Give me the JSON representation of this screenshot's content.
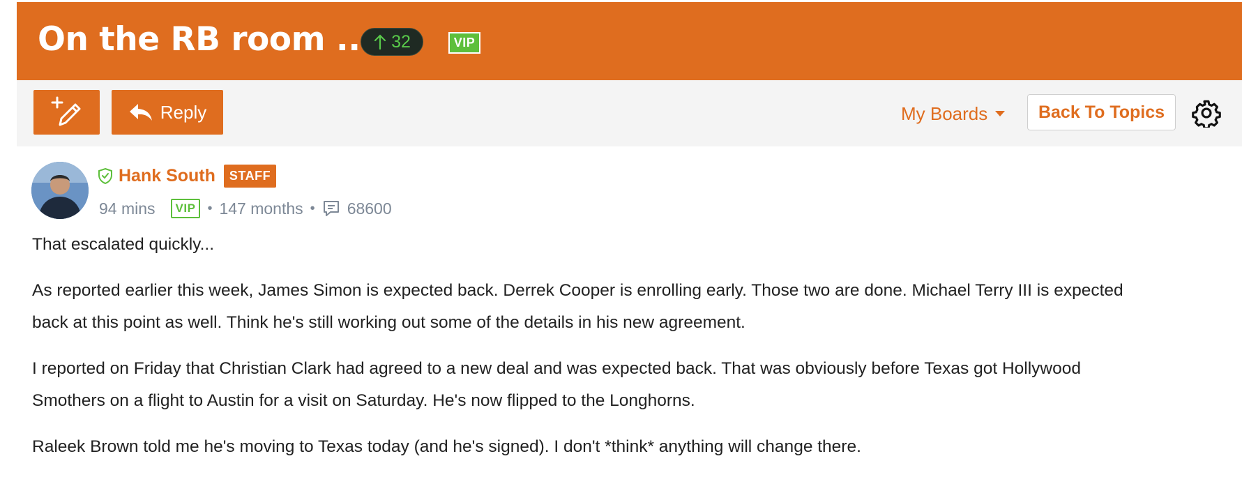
{
  "title_bar": {
    "title": "On the RB room ...",
    "vote_count": "32",
    "vip_label": "VIP",
    "bg_color": "#df6d1f"
  },
  "toolbar": {
    "new_topic_icon": "new-topic-pencil-icon",
    "reply_label": "Reply",
    "my_boards_label": "My Boards",
    "back_to_topics_label": "Back To Topics",
    "settings_icon": "gear-icon"
  },
  "post": {
    "author": "Hank South",
    "author_badge": "STAFF",
    "time_ago": "94 mins",
    "vip_label": "VIP",
    "member_duration": "147 months",
    "post_count": "68600",
    "paragraphs": [
      "That escalated quickly...",
      "As reported earlier this week, James Simon is expected back. Derrek Cooper is enrolling early. Those two are done. Michael Terry III is expected",
      "back at this point as well. Think he's still working out some of the details in his new agreement.",
      "I reported on Friday that Christian Clark had agreed to a new deal and was expected back. That was obviously before Texas got Hollywood",
      "Smothers on a flight to Austin for a visit on Saturday. He's now flipped to the Longhorns.",
      "Raleek Brown told me he's moving to Texas today (and he's signed). I don't *think* anything will change there."
    ]
  },
  "colors": {
    "accent": "#df6d1f",
    "vip_green": "#5dbf3b",
    "meta_gray": "#7d8896"
  }
}
